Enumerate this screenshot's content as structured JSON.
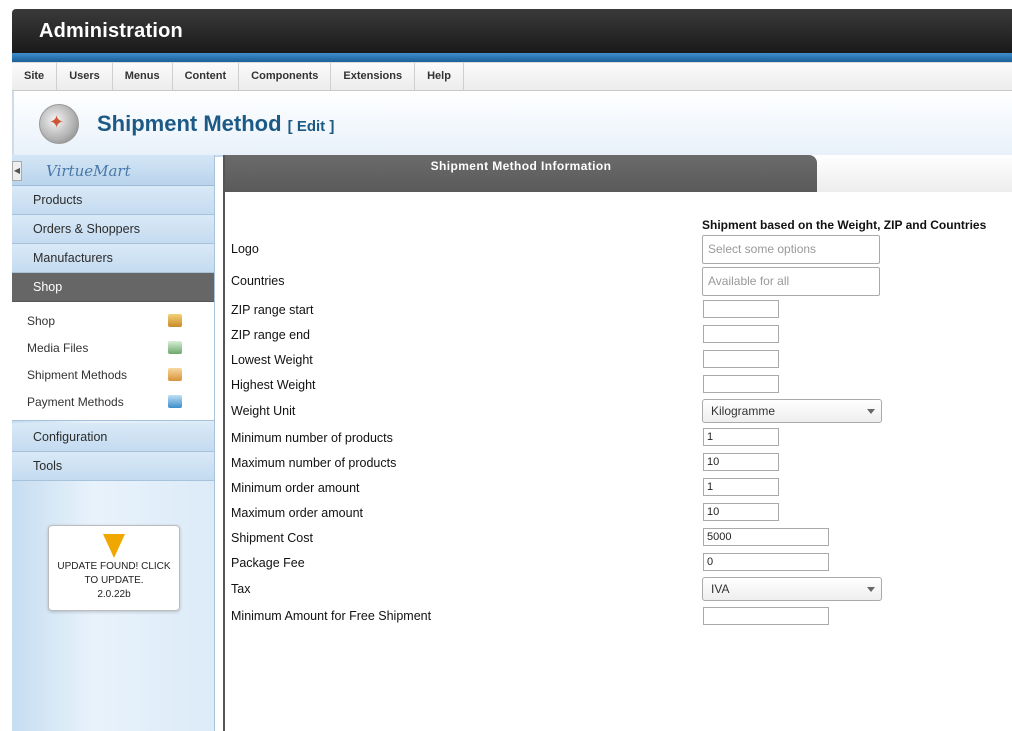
{
  "header": {
    "title": "Administration"
  },
  "menu": [
    "Site",
    "Users",
    "Menus",
    "Content",
    "Components",
    "Extensions",
    "Help"
  ],
  "page": {
    "title": "Shipment Method",
    "edit": "[ Edit ]"
  },
  "sidebar": {
    "logo": "VirtueMart",
    "top_items": [
      "Products",
      "Orders & Shoppers",
      "Manufacturers"
    ],
    "active": "Shop",
    "sub_items": [
      {
        "label": "Shop",
        "icon": "shop-icon"
      },
      {
        "label": "Media Files",
        "icon": "media-files-icon"
      },
      {
        "label": "Shipment Methods",
        "icon": "truck-icon"
      },
      {
        "label": "Payment Methods",
        "icon": "payment-icon"
      }
    ],
    "bottom_items": [
      "Configuration",
      "Tools"
    ],
    "update": {
      "line1": "UPDATE FOUND! CLICK",
      "line2": "TO UPDATE.",
      "version": "2.0.22b"
    }
  },
  "tab": {
    "title": "Shipment Method Information"
  },
  "form": {
    "description": "Shipment based on the Weight, ZIP and Countries",
    "logo_label": "Logo",
    "logo_placeholder": "Select some options",
    "countries_label": "Countries",
    "countries_placeholder": "Available for all",
    "zip_start_label": "ZIP range start",
    "zip_start": "",
    "zip_end_label": "ZIP range end",
    "zip_end": "",
    "lowest_weight_label": "Lowest Weight",
    "lowest_weight": "",
    "highest_weight_label": "Highest Weight",
    "highest_weight": "",
    "weight_unit_label": "Weight Unit",
    "weight_unit": "Kilogramme",
    "min_products_label": "Minimum number of products",
    "min_products": "1",
    "max_products_label": "Maximum number of products",
    "max_products": "10",
    "min_order_label": "Minimum order amount",
    "min_order": "1",
    "max_order_label": "Maximum order amount",
    "max_order": "10",
    "shipment_cost_label": "Shipment Cost",
    "shipment_cost": "5000",
    "package_fee_label": "Package Fee",
    "package_fee": "0",
    "tax_label": "Tax",
    "tax": "IVA",
    "free_shipment_label": "Minimum Amount for Free Shipment",
    "free_shipment": ""
  }
}
